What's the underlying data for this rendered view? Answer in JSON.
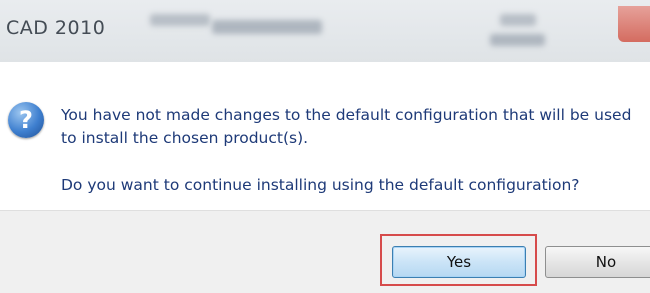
{
  "window": {
    "title": "CAD 2010"
  },
  "dialog": {
    "message_line1": "You have not made changes to the default configuration that will be used to install the chosen product(s).",
    "message_line2": "Do you want to continue installing using the default configuration?",
    "icon": "question-icon"
  },
  "buttons": {
    "yes_label": "Yes",
    "no_label": "No"
  },
  "colors": {
    "message_text": "#1e3a78",
    "highlight_border": "#d64b4b",
    "default_button_border": "#3c7fb1"
  }
}
